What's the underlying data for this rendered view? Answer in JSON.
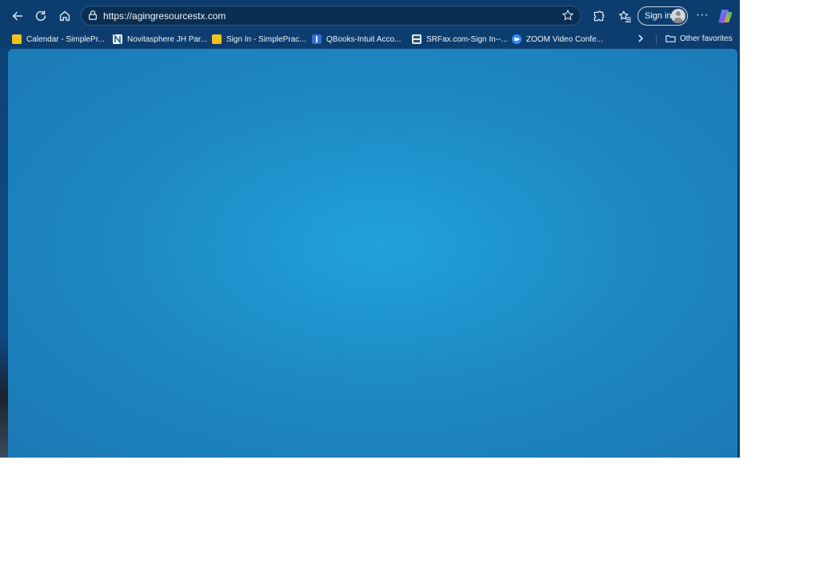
{
  "browser": {
    "url": "https://agingresourcestx.com",
    "signin_label": "Sign in",
    "more_label": "···"
  },
  "favorites": [
    {
      "label": "Calendar - SimplePr...",
      "icon": "simplepractice-icon",
      "color": "#f2c21b"
    },
    {
      "label": "Novitasphere JH Par...",
      "icon": "novitasphere-icon",
      "color": "#ffffff"
    },
    {
      "label": "Sign In - SimplePrac...",
      "icon": "simplepractice-icon",
      "color": "#f2c21b"
    },
    {
      "label": "QBooks-Intuit Acco...",
      "icon": "qbooks-icon",
      "color": "#2d6fd6"
    },
    {
      "label": "SRFax.com-Sign In--...",
      "icon": "srfax-icon",
      "color": "#dfe6ee"
    },
    {
      "label": "ZOOM Video Confe...",
      "icon": "zoom-icon",
      "color": "#2d8cff"
    }
  ],
  "other_favorites_label": "Other favorites",
  "colors": {
    "chrome": "#0c3d6e",
    "content_center": "#22a2da",
    "content_edge": "#1b79b5"
  }
}
